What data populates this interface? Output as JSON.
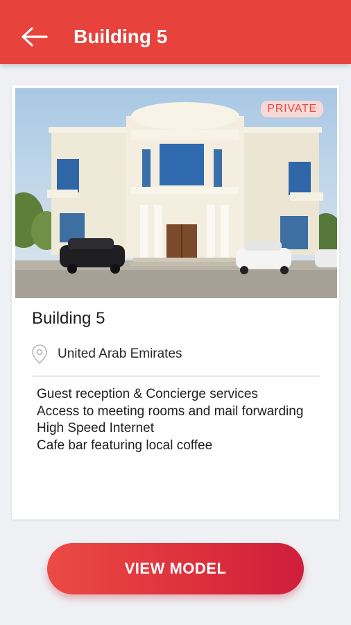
{
  "header": {
    "title": "Building 5",
    "back_icon": "arrow-left-icon",
    "color": "#e8423c"
  },
  "card": {
    "badge": "PRIVATE",
    "title": "Building 5",
    "location_icon": "location-pin-icon",
    "location": "United Arab Emirates",
    "amenities": [
      "Guest reception & Concierge services",
      "Access to meeting rooms and mail forwarding",
      "High Speed Internet",
      "Cafe bar featuring local coffee"
    ]
  },
  "actions": {
    "view_model_label": "VIEW MODEL",
    "button_color": "#dc2f3c"
  }
}
